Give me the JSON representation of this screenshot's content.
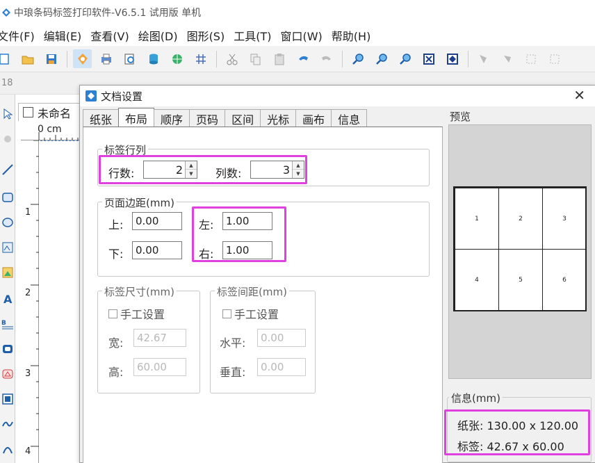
{
  "app": {
    "title": "中琅条码标签打印软件-V6.5.1 试用版 单机"
  },
  "menu": [
    "文件(F)",
    "编辑(E)",
    "查看(V)",
    "绘图(D)",
    "图形(S)",
    "工具(T)",
    "窗口(W)",
    "帮助(H)"
  ],
  "toolbar_icons": [
    "new-icon",
    "open-icon",
    "save-icon",
    "hand-icon",
    "print-icon",
    "print-preview-icon",
    "database-icon",
    "globe-icon",
    "grid-icon",
    "cut-icon",
    "copy-icon",
    "paste-icon",
    "undo-icon",
    "redo-icon",
    "zoom-in-icon",
    "zoom-out-icon",
    "zoom-icon",
    "fit-icon",
    "actual-size-icon",
    "tool-a-icon",
    "tool-b-icon",
    "tool-c-icon",
    "tool-d-icon"
  ],
  "toolbar2": {
    "ruler_label": "18"
  },
  "document_tab": {
    "label": "未命名"
  },
  "ruler": {
    "unit": "0 cm",
    "marks": [
      "1",
      "2",
      "3",
      "4"
    ]
  },
  "dialog": {
    "title": "文档设置",
    "close": "✕",
    "tabs": [
      "纸张",
      "布局",
      "顺序",
      "页码",
      "区间",
      "光标",
      "画布",
      "信息"
    ],
    "selected_tab": "布局",
    "label_rows_cols": {
      "title": "标签行列",
      "rows_label": "行数:",
      "rows_value": "2",
      "cols_label": "列数:",
      "cols_value": "3"
    },
    "page_margins": {
      "title": "页面边距(mm)",
      "top_label": "上:",
      "top_value": "0.00",
      "bottom_label": "下:",
      "bottom_value": "0.00",
      "left_label": "左:",
      "left_value": "1.00",
      "right_label": "右:",
      "right_value": "1.00"
    },
    "label_size": {
      "title": "标签尺寸(mm)",
      "manual_label": "手工设置",
      "width_label": "宽:",
      "width_value": "42.67",
      "height_label": "高:",
      "height_value": "60.00"
    },
    "label_spacing": {
      "title": "标签间距(mm)",
      "manual_label": "手工设置",
      "horizontal_label": "水平:",
      "horizontal_value": "0.00",
      "vertical_label": "垂直:",
      "vertical_value": "0.00"
    },
    "preview": {
      "title": "预览",
      "cells": [
        "1",
        "2",
        "3",
        "4",
        "5",
        "6"
      ]
    },
    "info": {
      "title": "信息(mm)",
      "paper_label": "纸张:",
      "paper_value": "130.00 x 120.00",
      "label_label": "标签:",
      "label_value": "42.67 x 60.00"
    }
  },
  "colors": {
    "highlight": "#e040e0",
    "accent": "#2d7fd3"
  }
}
